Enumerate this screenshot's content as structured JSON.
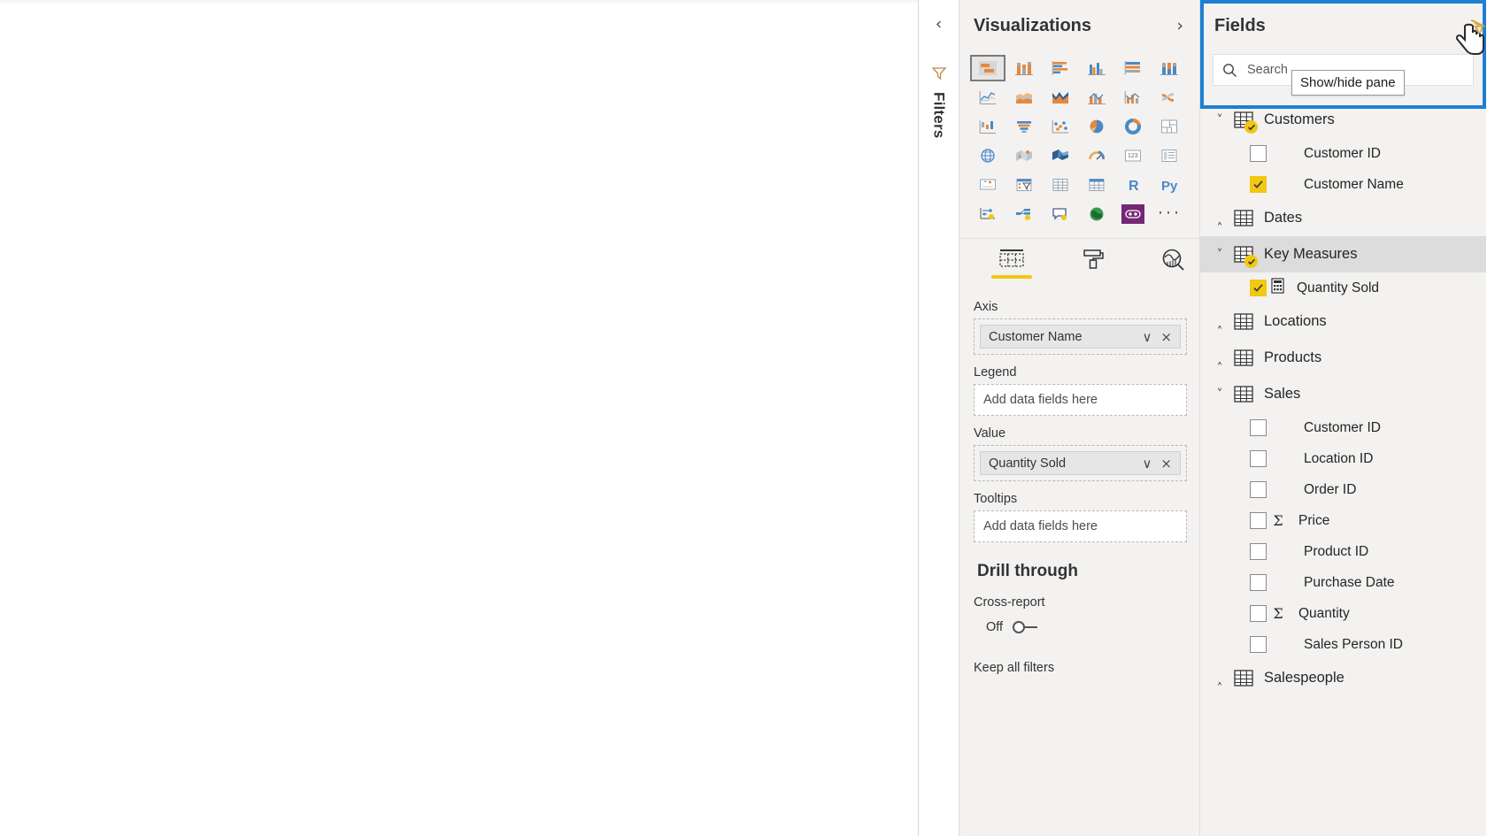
{
  "filters_rail": {
    "collapse_label": "‹",
    "label": "Filters",
    "funnel_icon": "funnel-icon"
  },
  "visualizations": {
    "title": "Visualizations",
    "expand_label": "›",
    "gallery": [
      {
        "name": "stacked-bar-chart-icon",
        "selected": true
      },
      {
        "name": "stacked-column-chart-icon",
        "selected": false
      },
      {
        "name": "clustered-bar-chart-icon",
        "selected": false
      },
      {
        "name": "clustered-column-chart-icon",
        "selected": false
      },
      {
        "name": "100-percent-stacked-bar-chart-icon",
        "selected": false
      },
      {
        "name": "100-percent-stacked-column-chart-icon",
        "selected": false
      },
      {
        "name": "line-chart-icon",
        "selected": false
      },
      {
        "name": "area-chart-icon",
        "selected": false
      },
      {
        "name": "stacked-area-chart-icon",
        "selected": false
      },
      {
        "name": "line-and-stacked-column-chart-icon",
        "selected": false
      },
      {
        "name": "line-and-clustered-column-chart-icon",
        "selected": false
      },
      {
        "name": "ribbon-chart-icon",
        "selected": false
      },
      {
        "name": "waterfall-chart-icon",
        "selected": false
      },
      {
        "name": "funnel-chart-icon",
        "selected": false
      },
      {
        "name": "scatter-chart-icon",
        "selected": false
      },
      {
        "name": "pie-chart-icon",
        "selected": false
      },
      {
        "name": "donut-chart-icon",
        "selected": false
      },
      {
        "name": "treemap-icon",
        "selected": false
      },
      {
        "name": "map-icon",
        "selected": false
      },
      {
        "name": "filled-map-icon",
        "selected": false
      },
      {
        "name": "shape-map-icon",
        "selected": false
      },
      {
        "name": "gauge-icon",
        "selected": false
      },
      {
        "name": "card-icon",
        "selected": false
      },
      {
        "name": "multi-row-card-icon",
        "selected": false
      },
      {
        "name": "kpi-icon",
        "selected": false
      },
      {
        "name": "slicer-icon",
        "selected": false
      },
      {
        "name": "table-icon",
        "selected": false
      },
      {
        "name": "matrix-icon",
        "selected": false
      },
      {
        "name": "r-script-visual-icon",
        "selected": false
      },
      {
        "name": "python-visual-icon",
        "selected": false
      },
      {
        "name": "key-influencers-icon",
        "selected": false
      },
      {
        "name": "decomposition-tree-icon",
        "selected": false
      },
      {
        "name": "qa-visual-icon",
        "selected": false
      },
      {
        "name": "arcgis-maps-icon",
        "selected": false
      },
      {
        "name": "power-apps-visual-icon",
        "selected": false
      },
      {
        "name": "more-options-icon",
        "selected": false
      }
    ],
    "more_label": "···",
    "well_tabs": [
      {
        "name": "fields-tab",
        "icon": "fields-grid-icon",
        "active": true
      },
      {
        "name": "format-tab",
        "icon": "paint-roller-icon",
        "active": false
      },
      {
        "name": "analytics-tab",
        "icon": "analytics-magnifier-icon",
        "active": false
      }
    ],
    "wells": [
      {
        "label": "Axis",
        "chips": [
          {
            "name": "Customer Name",
            "caret": "∨",
            "close": "×"
          }
        ],
        "placeholder": null
      },
      {
        "label": "Legend",
        "chips": [],
        "placeholder": "Add data fields here"
      },
      {
        "label": "Value",
        "chips": [
          {
            "name": "Quantity Sold",
            "caret": "∨",
            "close": "×"
          }
        ],
        "placeholder": null
      },
      {
        "label": "Tooltips",
        "chips": [],
        "placeholder": "Add data fields here"
      }
    ],
    "drill_through": {
      "title": "Drill through",
      "cross_report_label": "Cross-report",
      "toggle_state": "Off",
      "keep_all_filters_label": "Keep all filters"
    }
  },
  "fields": {
    "title": "Fields",
    "search_placeholder": "Search",
    "search_icon": "search-icon",
    "tooltip": "Show/hide pane",
    "cursor_icon": "hand-pointer-cursor",
    "highlight_color": "#1f7fd4",
    "tree": [
      {
        "type": "table",
        "name": "Customers",
        "expanded": true,
        "checked_badge": true,
        "selected": false,
        "children": [
          {
            "name": "Customer ID",
            "checked": false,
            "measure": false,
            "sigma": false
          },
          {
            "name": "Customer Name",
            "checked": true,
            "measure": false,
            "sigma": false
          }
        ]
      },
      {
        "type": "table",
        "name": "Dates",
        "expanded": false,
        "checked_badge": false,
        "selected": false,
        "children": []
      },
      {
        "type": "table",
        "name": "Key Measures",
        "expanded": true,
        "checked_badge": true,
        "selected": true,
        "children": [
          {
            "name": "Quantity Sold",
            "checked": true,
            "measure": true,
            "sigma": false
          }
        ]
      },
      {
        "type": "table",
        "name": "Locations",
        "expanded": false,
        "checked_badge": false,
        "selected": false,
        "children": []
      },
      {
        "type": "table",
        "name": "Products",
        "expanded": false,
        "checked_badge": false,
        "selected": false,
        "children": []
      },
      {
        "type": "table",
        "name": "Sales",
        "expanded": true,
        "checked_badge": false,
        "selected": false,
        "children": [
          {
            "name": "Customer ID",
            "checked": false,
            "measure": false,
            "sigma": false
          },
          {
            "name": "Location ID",
            "checked": false,
            "measure": false,
            "sigma": false
          },
          {
            "name": "Order ID",
            "checked": false,
            "measure": false,
            "sigma": false
          },
          {
            "name": "Price",
            "checked": false,
            "measure": false,
            "sigma": true
          },
          {
            "name": "Product ID",
            "checked": false,
            "measure": false,
            "sigma": false
          },
          {
            "name": "Purchase Date",
            "checked": false,
            "measure": false,
            "sigma": false
          },
          {
            "name": "Quantity",
            "checked": false,
            "measure": false,
            "sigma": true
          },
          {
            "name": "Sales Person ID",
            "checked": false,
            "measure": false,
            "sigma": false
          }
        ]
      },
      {
        "type": "table",
        "name": "Salespeople",
        "expanded": false,
        "checked_badge": false,
        "selected": false,
        "children": []
      }
    ]
  }
}
